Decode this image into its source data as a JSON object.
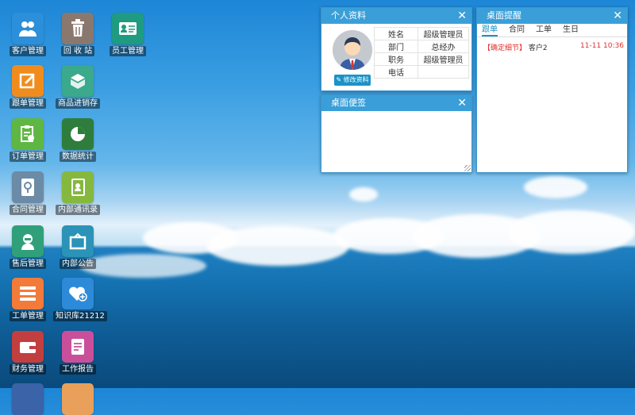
{
  "desktop": {
    "apps": [
      {
        "label": "客户管理",
        "icon": "customers-icon",
        "color": "#2c8fd9"
      },
      {
        "label": "回 收 站",
        "icon": "trash-icon",
        "color": "#8a786e"
      },
      {
        "label": "员工管理",
        "icon": "employee-card-icon",
        "color": "#1e9b80"
      },
      {
        "label": "跟单管理",
        "icon": "edit-note-icon",
        "color": "#f08c1d"
      },
      {
        "label": "商品进销存",
        "icon": "inventory-box-icon",
        "color": "#3aa98c"
      },
      {
        "label": "订单管理",
        "icon": "order-clipboard-icon",
        "color": "#5fb743"
      },
      {
        "label": "数据统计",
        "icon": "pie-chart-icon",
        "color": "#2f7d3c"
      },
      {
        "label": "合同管理",
        "icon": "contract-icon",
        "color": "#6c8ba6"
      },
      {
        "label": "内部通讯录",
        "icon": "address-book-icon",
        "color": "#85b83e"
      },
      {
        "label": "售后管理",
        "icon": "support-agent-icon",
        "color": "#2fa07a"
      },
      {
        "label": "内部公告",
        "icon": "announcement-icon",
        "color": "#2a93b7"
      },
      {
        "label": "工单管理",
        "icon": "list-icon",
        "color": "#f27b3a"
      },
      {
        "label": "知识库21212",
        "icon": "heart-plus-icon",
        "color": "#2d8ad8"
      },
      {
        "label": "财务管理",
        "icon": "wallet-icon",
        "color": "#c23f3f"
      },
      {
        "label": "工作报告",
        "icon": "report-icon",
        "color": "#c94f9a"
      }
    ]
  },
  "profile": {
    "title": "个人资料",
    "edit_label": "修改资料",
    "rows": [
      {
        "key": "姓名",
        "value": "超级管理员"
      },
      {
        "key": "部门",
        "value": "总经办"
      },
      {
        "key": "职务",
        "value": "超级管理员"
      },
      {
        "key": "电话",
        "value": ""
      }
    ]
  },
  "notes": {
    "title": "桌面便签",
    "content": ""
  },
  "reminder": {
    "title": "桌面提醒",
    "tabs": [
      "跟单",
      "合同",
      "工单",
      "生日"
    ],
    "items": [
      {
        "tag": "【确定细节】",
        "text": "客户2",
        "time": "11-11 10:36"
      }
    ]
  },
  "colors": {
    "panel_header": "#3a9fd8",
    "accent": "#1a93c7",
    "alert": "#e0302b"
  }
}
